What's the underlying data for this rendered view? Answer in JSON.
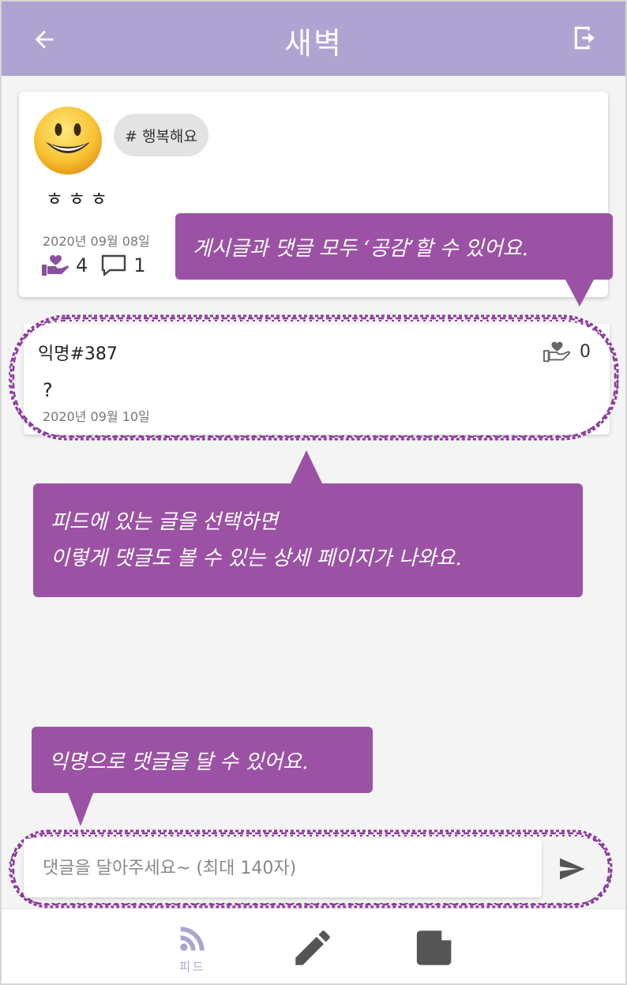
{
  "header": {
    "title": "새벽",
    "back_icon": "arrow-left-icon",
    "logout_icon": "logout-icon",
    "color": "#aea3d1"
  },
  "post": {
    "emoji_icon": "smiling-face-icon",
    "tag": "# 행복해요",
    "body": "ㅎㅎㅎ",
    "date": "2020년 09월 08일",
    "empathy_count": "4",
    "comment_count": "1"
  },
  "comment": {
    "author": "익명#387",
    "text": "?",
    "date": "2020년 09월 10일",
    "empathy_count": "0"
  },
  "callouts": {
    "empathy": "게시글과 댓글 모두 ‘공감’할 수 있어요.",
    "detail_line1": "피드에 있는 글을 선택하면",
    "detail_line2": "이렇게 댓글도 볼 수 있는 상세 페이지가 나와요.",
    "anonymous": "익명으로 댓글을 달 수 있어요.",
    "color": "#9b52a4"
  },
  "comment_input": {
    "placeholder": "댓글을 달아주세요~ (최대 140자)",
    "value": ""
  },
  "bottom_nav": {
    "feed_label": "피드",
    "active_color": "#aea3d1",
    "icons": [
      "rss-feed-icon",
      "pencil-icon",
      "note-icon"
    ]
  }
}
